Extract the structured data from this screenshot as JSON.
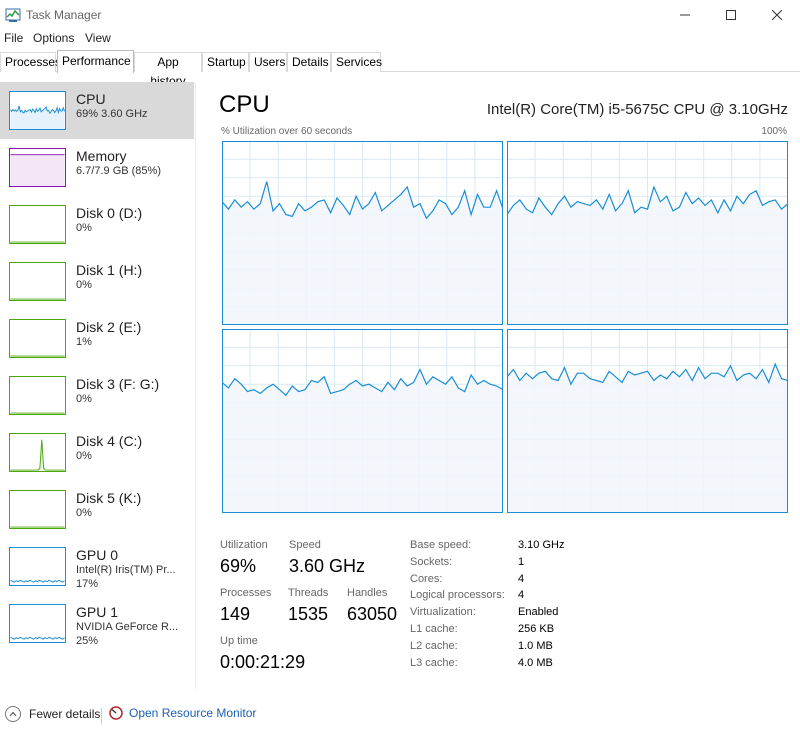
{
  "window": {
    "title": "Task Manager"
  },
  "menu": [
    "File",
    "Options",
    "View"
  ],
  "tabs": [
    "Processes",
    "Performance",
    "App history",
    "Startup",
    "Users",
    "Details",
    "Services"
  ],
  "active_tab": "Performance",
  "colors": {
    "cpu": "#1a8ed5",
    "memory": "#8b12ae",
    "disk": "#4da60c",
    "gpu": "#1a8ed5",
    "graph_fill": "#f1f6fa",
    "graph_grid": "#d9eaf4",
    "link": "#1a5fb4"
  },
  "sidebar": {
    "items": [
      {
        "name": "CPU",
        "line1": "69% 3.60 GHz",
        "line2": "",
        "kind": "cpu"
      },
      {
        "name": "Memory",
        "line1": "6.7/7.9 GB (85%)",
        "line2": "",
        "kind": "memory"
      },
      {
        "name": "Disk 0 (D:)",
        "line1": "0%",
        "line2": "",
        "kind": "disk"
      },
      {
        "name": "Disk 1 (H:)",
        "line1": "0%",
        "line2": "",
        "kind": "disk"
      },
      {
        "name": "Disk 2 (E:)",
        "line1": "1%",
        "line2": "",
        "kind": "disk"
      },
      {
        "name": "Disk 3 (F: G:)",
        "line1": "0%",
        "line2": "",
        "kind": "disk"
      },
      {
        "name": "Disk 4 (C:)",
        "line1": "0%",
        "line2": "",
        "kind": "disk"
      },
      {
        "name": "Disk 5 (K:)",
        "line1": "0%",
        "line2": "",
        "kind": "disk"
      },
      {
        "name": "GPU 0",
        "line1": "Intel(R) Iris(TM) Pr...",
        "line2": "17%",
        "kind": "gpu"
      },
      {
        "name": "GPU 1",
        "line1": "NVIDIA GeForce R...",
        "line2": "25%",
        "kind": "gpu"
      }
    ]
  },
  "main": {
    "title": "CPU",
    "model": "Intel(R) Core(TM) i5-5675C CPU @ 3.10GHz",
    "util_label": "% Utilization over 60 seconds",
    "util_max": "100%"
  },
  "stats": {
    "utilization": {
      "label": "Utilization",
      "value": "69%"
    },
    "speed": {
      "label": "Speed",
      "value": "3.60 GHz"
    },
    "processes": {
      "label": "Processes",
      "value": "149"
    },
    "threads": {
      "label": "Threads",
      "value": "1535"
    },
    "handles": {
      "label": "Handles",
      "value": "63050"
    },
    "uptime": {
      "label": "Up time",
      "value": "0:00:21:29"
    }
  },
  "specs": [
    {
      "label": "Base speed:",
      "value": "3.10 GHz"
    },
    {
      "label": "Sockets:",
      "value": "1"
    },
    {
      "label": "Cores:",
      "value": "4"
    },
    {
      "label": "Logical processors:",
      "value": "4"
    },
    {
      "label": "Virtualization:",
      "value": "Enabled"
    },
    {
      "label": "L1 cache:",
      "value": "256 KB"
    },
    {
      "label": "L2 cache:",
      "value": "1.0 MB"
    },
    {
      "label": "L3 cache:",
      "value": "4.0 MB"
    }
  ],
  "footer": {
    "fewer_details": "Fewer details",
    "open_monitor": "Open Resource Monitor"
  },
  "core_graphs": [
    {
      "core": 0,
      "values": [
        67,
        63,
        68,
        64,
        67,
        63,
        66,
        78,
        62,
        66,
        60,
        59,
        66,
        62,
        64,
        67,
        68,
        61,
        69,
        65,
        60,
        70,
        63,
        66,
        72,
        62,
        65,
        68,
        71,
        75,
        64,
        66,
        58,
        62,
        68,
        66,
        60,
        64,
        73,
        60,
        71,
        64,
        64,
        73,
        63
      ]
    },
    {
      "core": 1,
      "values": [
        60,
        65,
        68,
        63,
        61,
        69,
        64,
        60,
        66,
        70,
        64,
        67,
        66,
        65,
        68,
        63,
        71,
        62,
        66,
        73,
        61,
        64,
        63,
        75,
        67,
        70,
        62,
        64,
        72,
        66,
        69,
        65,
        68,
        61,
        68,
        62,
        70,
        66,
        71,
        73,
        65,
        67,
        68,
        63,
        66
      ]
    },
    {
      "core": 2,
      "values": [
        71,
        68,
        73,
        70,
        66,
        67,
        65,
        68,
        70,
        67,
        64,
        69,
        66,
        67,
        72,
        71,
        74,
        65,
        66,
        67,
        70,
        72,
        69,
        70,
        68,
        66,
        71,
        67,
        73,
        69,
        71,
        78,
        70,
        74,
        72,
        70,
        74,
        68,
        66,
        75,
        70,
        72,
        70,
        69,
        67
      ]
    },
    {
      "core": 3,
      "values": [
        74,
        78,
        72,
        76,
        73,
        76,
        77,
        73,
        72,
        79,
        70,
        76,
        76,
        73,
        72,
        71,
        77,
        74,
        71,
        77,
        75,
        76,
        77,
        72,
        75,
        73,
        77,
        74,
        78,
        72,
        79,
        73,
        76,
        76,
        74,
        80,
        72,
        75,
        76,
        73,
        78,
        71,
        81,
        73,
        72
      ]
    }
  ]
}
